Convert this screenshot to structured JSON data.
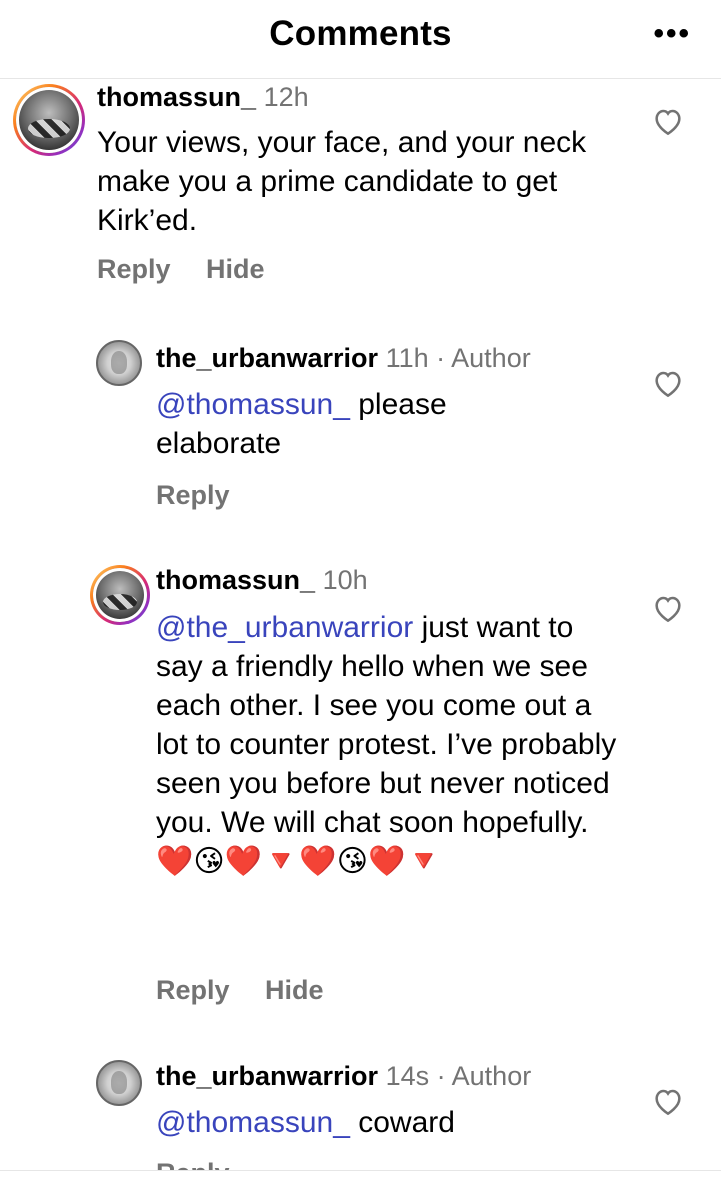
{
  "header": {
    "title": "Comments",
    "more_label": "•••"
  },
  "comments": [
    {
      "username": "thomassun_",
      "time": "12h",
      "text": "Your views, your face, and your neck make you a prime candidate to get Kirk’ed.",
      "actions": [
        "Reply",
        "Hide"
      ]
    },
    {
      "username": "the_urbanwarrior",
      "time": "11h",
      "separator": "·",
      "author_badge": "Author",
      "mention": "@thomassun_",
      "text": " please elaborate",
      "actions": [
        "Reply"
      ]
    },
    {
      "username": "thomassun_",
      "time": "10h",
      "mention": "@the_urbanwarrior",
      "text": " just want to say a friendly hello when we see each other.  I see you come out a lot to counter protest.  I’ve probably seen you before but never noticed you.  We will chat soon hopefully. ",
      "emojis": "❤️😘❤️🔻❤️😘❤️🔻",
      "actions": [
        "Reply",
        "Hide"
      ]
    },
    {
      "username": "the_urbanwarrior",
      "time": "14s",
      "separator": "·",
      "author_badge": "Author",
      "mention": "@thomassun_",
      "text": " coward",
      "actions": [
        "Reply"
      ]
    }
  ],
  "icons": {
    "more": "more-options-icon",
    "like": "heart-outline-icon"
  },
  "colors": {
    "mention": "#3944bc",
    "secondary_text": "#737373"
  }
}
